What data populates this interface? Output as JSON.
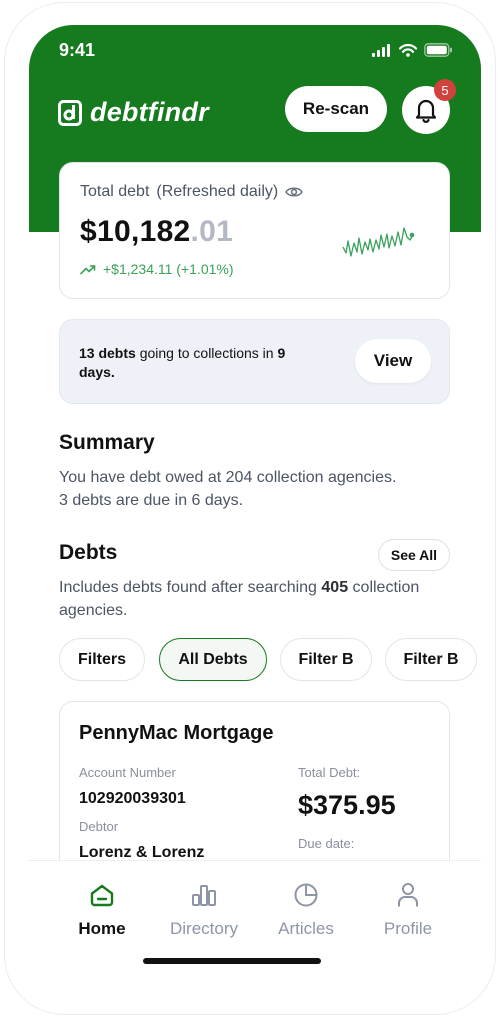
{
  "status_bar": {
    "time": "9:41"
  },
  "header": {
    "app_name": "debtfindr",
    "rescan_label": "Re-scan",
    "notification_count": "5",
    "brand_color": "#167a1e"
  },
  "total_card": {
    "label": "Total debt",
    "refresh_note": "(Refreshed daily)",
    "amount_main": "$10,182",
    "amount_cents": ".01",
    "change": "+$1,234.11 (+1.01%)",
    "sparkline_icon": "trend-sparkline"
  },
  "collections_notice": {
    "count": "13 debts",
    "text": " going to collections in ",
    "days": "9 days.",
    "view_label": "View"
  },
  "summary": {
    "title": "Summary",
    "line1": "You have debt owed at 204 collection agencies.",
    "line2": "3 debts are due in 6 days."
  },
  "debts": {
    "title": "Debts",
    "see_all_label": "See All",
    "desc_prefix": "Includes debts found after searching ",
    "desc_count": "405",
    "desc_suffix": " collection agencies.",
    "chips": [
      "Filters",
      "All Debts",
      "Filter B",
      "Filter B"
    ],
    "active_chip": "All Debts"
  },
  "debt_card": {
    "creditor": "PennyMac Mortgage",
    "account_label": "Account Number",
    "account_number": "102920039301",
    "debtor_label": "Debtor",
    "debtor": "Lorenz & Lorenz",
    "total_label": "Total Debt:",
    "total": "$375.95",
    "due_label": "Due date:"
  },
  "tabbar": {
    "tabs": [
      {
        "label": "Home",
        "icon": "home-icon"
      },
      {
        "label": "Directory",
        "icon": "bar-chart-icon"
      },
      {
        "label": "Articles",
        "icon": "pie-chart-icon"
      },
      {
        "label": "Profile",
        "icon": "person-icon"
      }
    ],
    "active": "Home"
  }
}
